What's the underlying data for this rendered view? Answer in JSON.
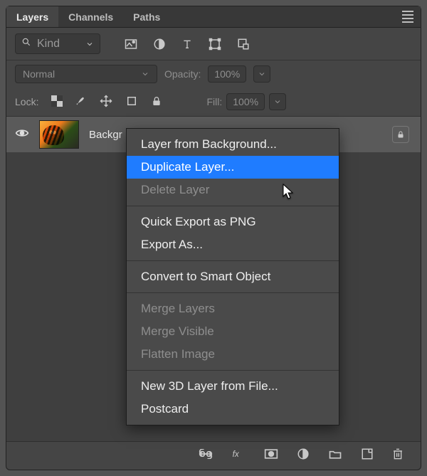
{
  "tabs": {
    "layers": "Layers",
    "channels": "Channels",
    "paths": "Paths"
  },
  "filter": {
    "kind_label": "Kind"
  },
  "blend": {
    "mode": "Normal",
    "opacity_label": "Opacity:",
    "opacity_value": "100%"
  },
  "lock": {
    "label": "Lock:",
    "fill_label": "Fill:",
    "fill_value": "100%"
  },
  "layer": {
    "name": "Backgr"
  },
  "context_menu": {
    "items": [
      {
        "label": "Layer from Background...",
        "disabled": false
      },
      {
        "label": "Duplicate Layer...",
        "disabled": false,
        "hover": true
      },
      {
        "label": "Delete Layer",
        "disabled": true
      },
      {
        "sep": true
      },
      {
        "label": "Quick Export as PNG",
        "disabled": false
      },
      {
        "label": "Export As...",
        "disabled": false
      },
      {
        "sep": true
      },
      {
        "label": "Convert to Smart Object",
        "disabled": false
      },
      {
        "sep": true
      },
      {
        "label": "Merge Layers",
        "disabled": true
      },
      {
        "label": "Merge Visible",
        "disabled": true
      },
      {
        "label": "Flatten Image",
        "disabled": true
      },
      {
        "sep": true
      },
      {
        "label": "New 3D Layer from File...",
        "disabled": false
      },
      {
        "label": "Postcard",
        "disabled": false
      }
    ]
  }
}
